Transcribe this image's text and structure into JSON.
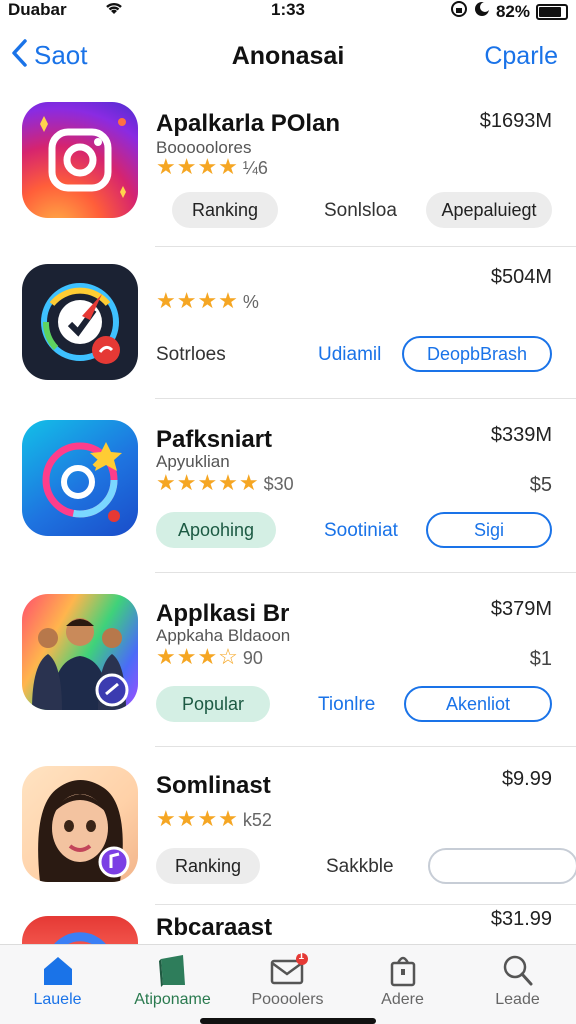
{
  "status_bar": {
    "carrier": "Duabar",
    "time": "1:33",
    "battery": "82%"
  },
  "nav": {
    "back_label": "Saot",
    "title": "Anonasai",
    "action_label": "Cparle"
  },
  "apps": [
    {
      "name": "Apalkarla POlan",
      "subtitle": "Booooolores",
      "stars": "★★★★",
      "rating_count": "¼6",
      "price": "$1693M",
      "pill_left": "Ranking",
      "middle_text": "Sonlsloa",
      "pill_right": "Apepaluiegt"
    },
    {
      "name": "",
      "stars": "★★★★",
      "rating_count": "%",
      "price": "$504M",
      "left_text": "Sotrloes",
      "link_text": "Udiamil",
      "outline_button": "DeopbBrash"
    },
    {
      "name": "Pafksniart",
      "subtitle": "Apyuklian",
      "stars": "★★★★★",
      "rating_count": "$30",
      "price": "$339M",
      "price2": "$5",
      "pill_left": "Apoohing",
      "link_text": "Sootiniat",
      "outline_button": "Sigi"
    },
    {
      "name": "Applkasi Br",
      "subtitle": "Appkaha Bldaoon",
      "stars": "★★★☆",
      "rating_count": "90",
      "price": "$379M",
      "price2": "$1",
      "pill_left": "Popular",
      "link_text": "Tionlre",
      "outline_button": "Akenliot"
    },
    {
      "name": "Somlinast",
      "stars": "★★★★",
      "rating_count": "k52",
      "price": "$9.99",
      "pill_left": "Ranking",
      "middle_text": "Sakkble",
      "outline_button": ""
    },
    {
      "name": "Rbcaraast",
      "price": "$31.99"
    }
  ],
  "tabs": [
    {
      "label": "Lauele",
      "icon": "home-icon"
    },
    {
      "label": "Atiponame",
      "icon": "book-icon"
    },
    {
      "label": "Poooolers",
      "icon": "mail-icon",
      "badge": "1"
    },
    {
      "label": "Adere",
      "icon": "bag-icon"
    },
    {
      "label": "Leade",
      "icon": "search-icon"
    }
  ],
  "colors": {
    "accent": "#1a73e8",
    "star": "#f5a623",
    "green_pill": "#d4efe4"
  }
}
